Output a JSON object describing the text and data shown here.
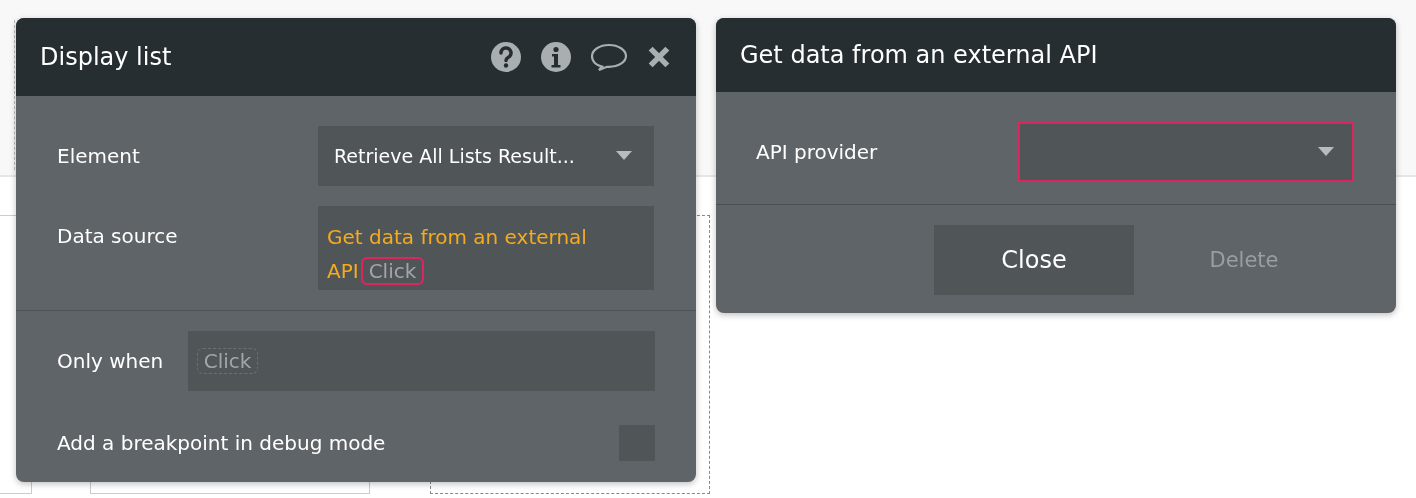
{
  "display_list": {
    "title": "Display list",
    "element": {
      "label": "Element",
      "value": "Retrieve All Lists Result..."
    },
    "data_source": {
      "label": "Data source",
      "value": "Get data from an external API",
      "chip": "Click",
      "chip_invalid": true
    },
    "only_when": {
      "label": "Only when",
      "chip": "Click"
    },
    "breakpoint": {
      "label": "Add a breakpoint in debug mode",
      "checked": false
    }
  },
  "api_panel": {
    "title": "Get data from an external API",
    "provider": {
      "label": "API provider",
      "invalid": true
    },
    "buttons": [
      {
        "label": "Close",
        "disabled": false
      },
      {
        "label": "Delete",
        "disabled": true
      }
    ]
  }
}
